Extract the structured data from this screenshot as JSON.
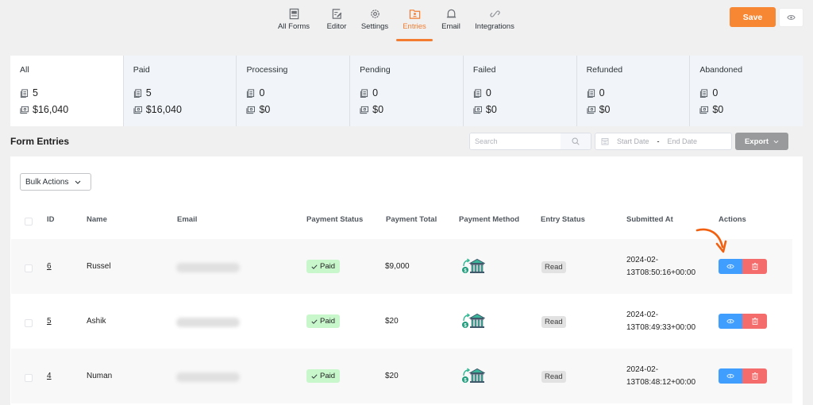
{
  "nav": {
    "items": [
      {
        "label": "All Forms",
        "icon": "forms-icon",
        "active": false
      },
      {
        "label": "Editor",
        "icon": "editor-icon",
        "active": false
      },
      {
        "label": "Settings",
        "icon": "gear-icon",
        "active": false
      },
      {
        "label": "Entries",
        "icon": "entries-icon",
        "active": true
      },
      {
        "label": "Email",
        "icon": "bell-icon",
        "active": false
      },
      {
        "label": "Integrations",
        "icon": "link-icon",
        "active": false
      }
    ],
    "save_label": "Save",
    "preview_icon": "eye-icon",
    "accent_color": "#f47c30"
  },
  "stats": [
    {
      "label": "All",
      "count": "5",
      "amount": "$16,040"
    },
    {
      "label": "Paid",
      "count": "5",
      "amount": "$16,040"
    },
    {
      "label": "Processing",
      "count": "0",
      "amount": "$0"
    },
    {
      "label": "Pending",
      "count": "0",
      "amount": "$0"
    },
    {
      "label": "Failed",
      "count": "0",
      "amount": "$0"
    },
    {
      "label": "Refunded",
      "count": "0",
      "amount": "$0"
    },
    {
      "label": "Abandoned",
      "count": "0",
      "amount": "$0"
    }
  ],
  "toolbar": {
    "title": "Form Entries",
    "search_placeholder": "Search",
    "start_date": "Start Date",
    "date_separator": "-",
    "end_date": "End Date",
    "export_label": "Export"
  },
  "table": {
    "bulk_actions_label": "Bulk Actions",
    "columns": [
      "ID",
      "Name",
      "Email",
      "Payment Status",
      "Payment Total",
      "Payment Method",
      "Entry Status",
      "Submitted At",
      "Actions"
    ],
    "rows": [
      {
        "id": "6",
        "name": "Russel",
        "email": "(blurred)",
        "payment_status": "Paid",
        "payment_total": "$9,000",
        "payment_method": "bank-transfer-icon",
        "entry_status": "Read",
        "submitted_date": "2024-02-",
        "submitted_time": "13T08:50:16+00:00"
      },
      {
        "id": "5",
        "name": "Ashik",
        "email": "(blurred)",
        "payment_status": "Paid",
        "payment_total": "$20",
        "payment_method": "bank-transfer-icon",
        "entry_status": "Read",
        "submitted_date": "2024-02-",
        "submitted_time": "13T08:49:33+00:00"
      },
      {
        "id": "4",
        "name": "Numan",
        "email": "(blurred)",
        "payment_status": "Paid",
        "payment_total": "$20",
        "payment_method": "bank-transfer-icon",
        "entry_status": "Read",
        "submitted_date": "2024-02-",
        "submitted_time": "13T08:48:12+00:00"
      }
    ]
  }
}
